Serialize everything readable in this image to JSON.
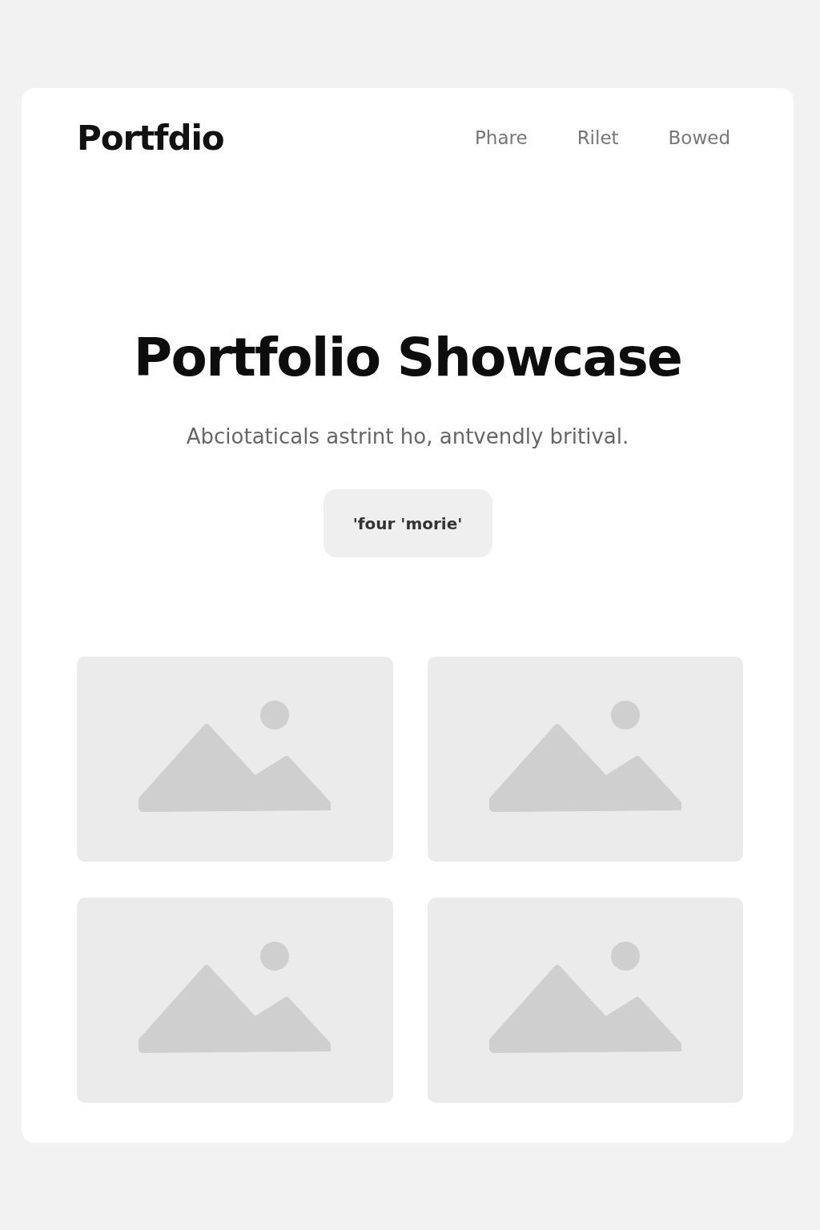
{
  "header": {
    "logo": "Portfdio",
    "nav": [
      {
        "label": "Phare"
      },
      {
        "label": "Rilet"
      },
      {
        "label": "Bowed"
      }
    ]
  },
  "hero": {
    "title": "Portfolio Showcase",
    "subtitle": "Abciotaticals astrint ho, antvendly britival.",
    "button": "'four 'morie'"
  },
  "gallery": [
    {
      "kind": "placeholder"
    },
    {
      "kind": "placeholder"
    },
    {
      "kind": "placeholder"
    },
    {
      "kind": "placeholder"
    }
  ]
}
